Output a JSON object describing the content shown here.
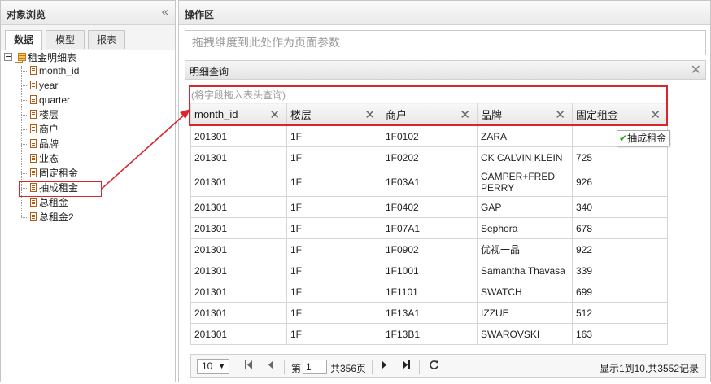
{
  "left_panel": {
    "title": "对象浏览",
    "collapse_glyph": "«",
    "tabs": [
      "数据",
      "模型",
      "报表"
    ],
    "tree": {
      "root": "租金明细表",
      "items": [
        "month_id",
        "year",
        "quarter",
        "楼层",
        "商户",
        "品牌",
        "业态",
        "固定租金",
        "抽成租金",
        "总租金",
        "总租金2"
      ]
    }
  },
  "right_panel": {
    "title": "操作区",
    "param_drop_placeholder": "拖拽维度到此处作为页面参数",
    "detail": {
      "title": "明细查询",
      "close_glyph": "✕",
      "drop_hint": "(将字段拖入表头查询)",
      "columns": [
        "month_id",
        "楼层",
        "商户",
        "品牌",
        "固定租金"
      ],
      "rows": [
        [
          "201301",
          "1F",
          "1F0102",
          "ZARA",
          ""
        ],
        [
          "201301",
          "1F",
          "1F0202",
          "CK CALVIN KLEIN",
          "725"
        ],
        [
          "201301",
          "1F",
          "1F03A1",
          "CAMPER+FRED PERRY",
          "926"
        ],
        [
          "201301",
          "1F",
          "1F0402",
          "GAP",
          "340"
        ],
        [
          "201301",
          "1F",
          "1F07A1",
          "Sephora",
          "678"
        ],
        [
          "201301",
          "1F",
          "1F0902",
          "优视一品",
          "922"
        ],
        [
          "201301",
          "1F",
          "1F1001",
          "Samantha Thavasa",
          "339"
        ],
        [
          "201301",
          "1F",
          "1F1101",
          "SWATCH",
          "699"
        ],
        [
          "201301",
          "1F",
          "1F13A1",
          "IZZUE",
          "512"
        ],
        [
          "201301",
          "1F",
          "1F13B1",
          "SWAROVSKI",
          "163"
        ]
      ],
      "drag_ghost": {
        "check": "✔",
        "label": "抽成租金"
      }
    },
    "pager": {
      "page_size": "10",
      "page_prefix": "第",
      "page_value": "1",
      "page_suffix": "共356页",
      "info": "显示1到10,共3552记录"
    }
  },
  "colors": {
    "highlight_border": "#d9262c",
    "check": "#3a9a2b"
  }
}
